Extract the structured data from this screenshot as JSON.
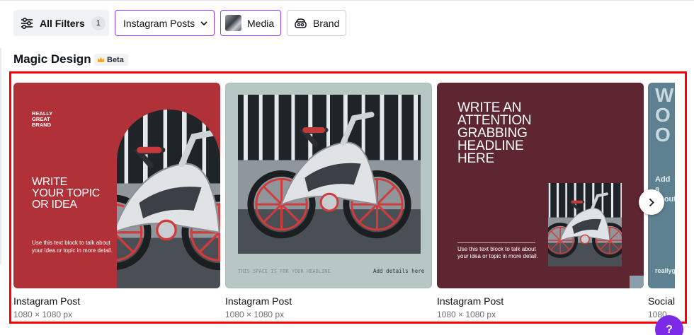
{
  "filters": {
    "all_filters_label": "All Filters",
    "all_filters_count": "1",
    "category_label": "Instagram Posts",
    "media_label": "Media",
    "brand_label": "Brand"
  },
  "section": {
    "title": "Magic Design",
    "badge": "Beta"
  },
  "cards": [
    {
      "name": "Instagram Post",
      "size": "1080 × 1080 px",
      "brand": "REALLY\nGREAT\nBRAND",
      "headline": "WRITE\nYOUR TOPIC\nOR IDEA",
      "body": "Use this text block to talk about your idea or topic in more detail."
    },
    {
      "name": "Instagram Post",
      "size": "1080 × 1080 px",
      "headline": "THIS SPACE IS FOR YOUR HEADLINE",
      "details": "Add details here"
    },
    {
      "name": "Instagram Post",
      "size": "1080 × 1080 px",
      "headline": "WRITE AN\nATTENTION\nGRABBING\nHEADLINE\nHERE",
      "body": "Use this text block to talk about your idea or topic in more detail."
    },
    {
      "name": "Social",
      "size": "1080",
      "headline": "W\nO\nO",
      "body": "Add a\nabout",
      "footer": "reallyg"
    }
  ],
  "colors": {
    "accent": "#8b3dff",
    "selection": "#ff0000",
    "card1_bg": "#b03138",
    "card2_bg": "#b6c7c4",
    "card3_bg": "#5d2630",
    "card4_bg": "#5d8190"
  },
  "icons": {
    "filters": "sliders-icon",
    "dropdown": "chevron-down-icon",
    "brand": "brand-kit-icon",
    "next": "chevron-right-icon",
    "help": "question-icon",
    "badge": "crown-icon"
  },
  "help_label": "?"
}
